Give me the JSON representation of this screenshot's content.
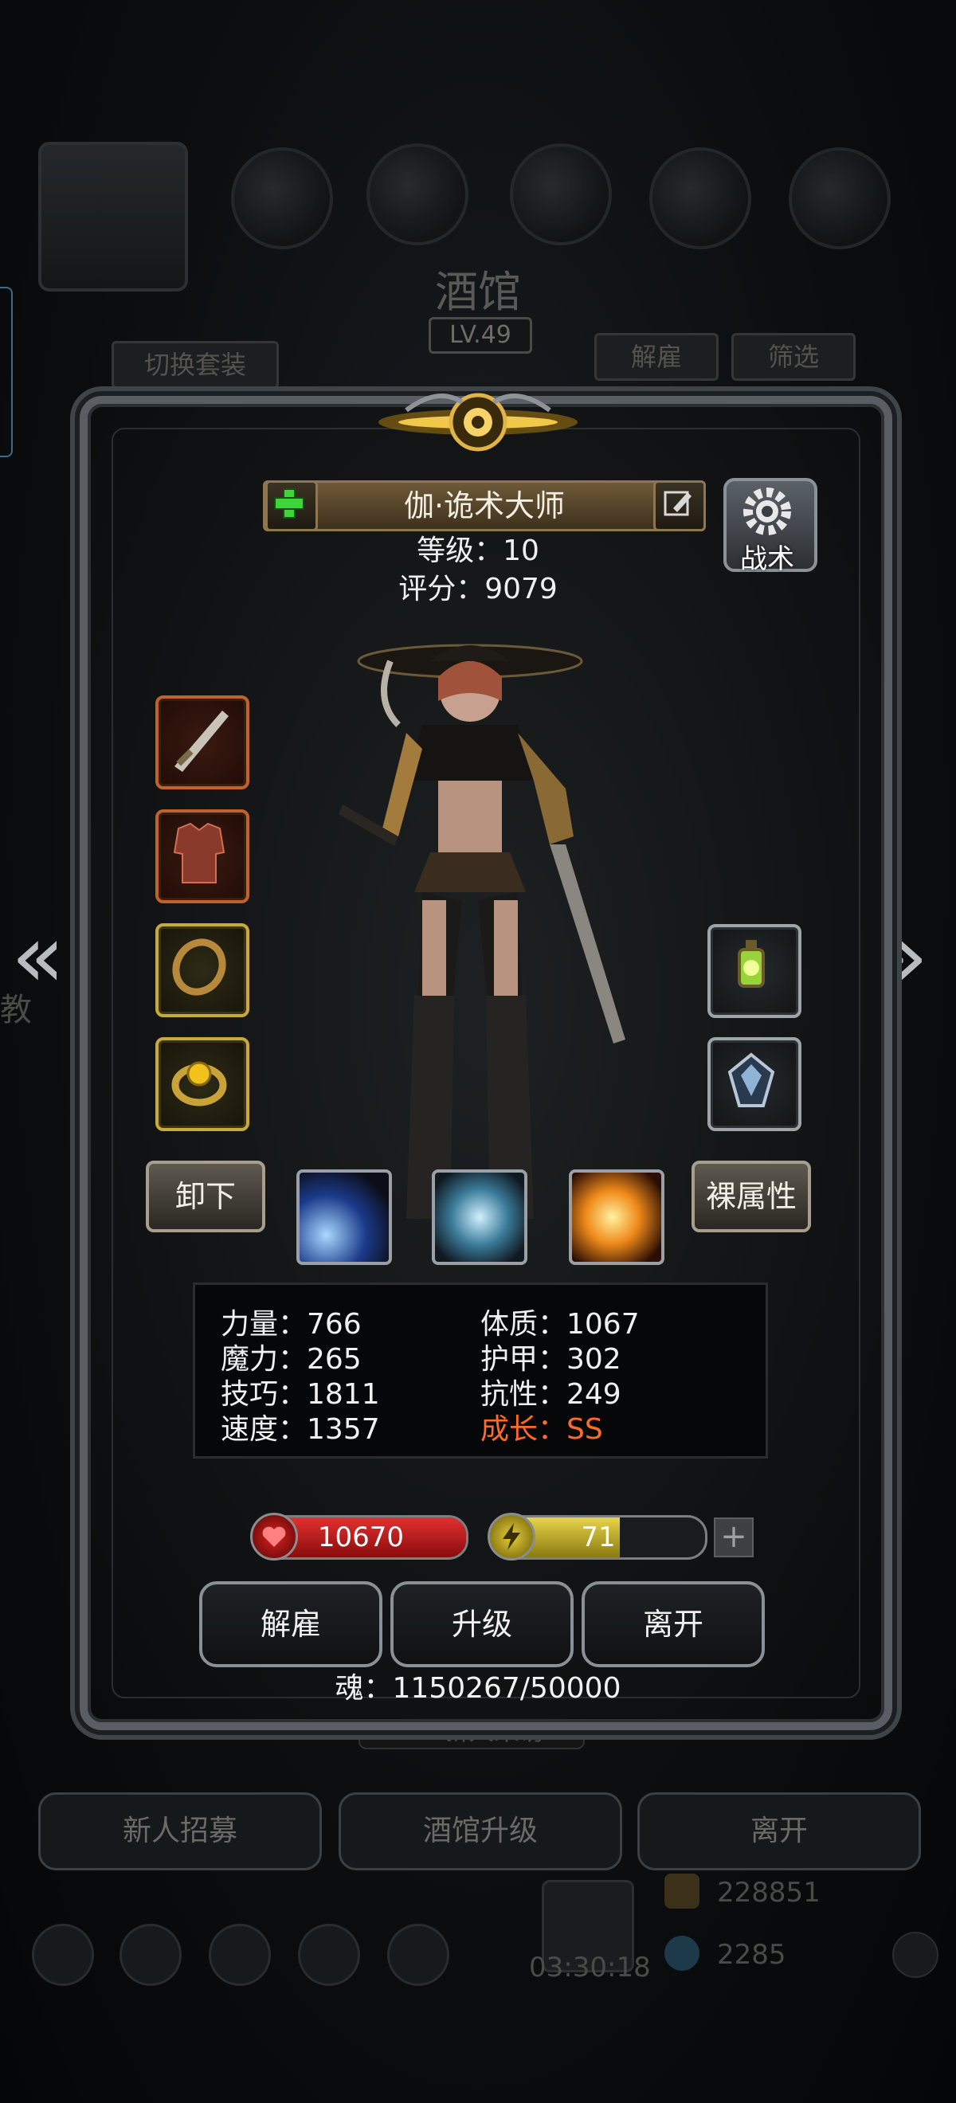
{
  "background": {
    "title": "酒馆",
    "level": "LV.49",
    "switch_outfit_label": "切换套装",
    "dismiss_label": "解雇",
    "filter_label": "筛选",
    "left_edge_text": "教",
    "visitor_label": "新人来访",
    "bottom_buttons": [
      "新人招募",
      "酒馆升级",
      "离开"
    ],
    "gold_amount": "228851",
    "gem_amount": "2285",
    "timer": "03:30:18"
  },
  "hero": {
    "name": "伽·诡术大师",
    "level_text": "等级：10",
    "score_text": "评分：9079",
    "tactics_label": "战术",
    "unequip_label": "卸下",
    "naked_attr_label": "裸属性"
  },
  "equipment": {
    "left": [
      "dagger-icon",
      "armor-icon",
      "ring-icon",
      "amulet-ring-icon"
    ],
    "right": [
      "lantern-icon",
      "crest-icon"
    ]
  },
  "skills": [
    "light-beam-skill-icon",
    "whirlwind-skill-icon",
    "fire-burst-skill-icon"
  ],
  "stats": {
    "left": [
      "力量：766",
      "魔力：265",
      "技巧：1811",
      "速度：1357"
    ],
    "right": [
      "体质：1067",
      "护甲：302",
      "抗性：249"
    ],
    "growth_label": "成长：",
    "growth_value": "SS",
    "growth_color": "#ff6a2a"
  },
  "bars": {
    "hp": "10670",
    "energy": "71",
    "energy_fill": 0.6,
    "hp_color": "#c41818",
    "energy_color": "#c9b42a"
  },
  "actions": [
    "解雇",
    "升级",
    "离开"
  ],
  "soul_text": "魂：1150267/50000"
}
